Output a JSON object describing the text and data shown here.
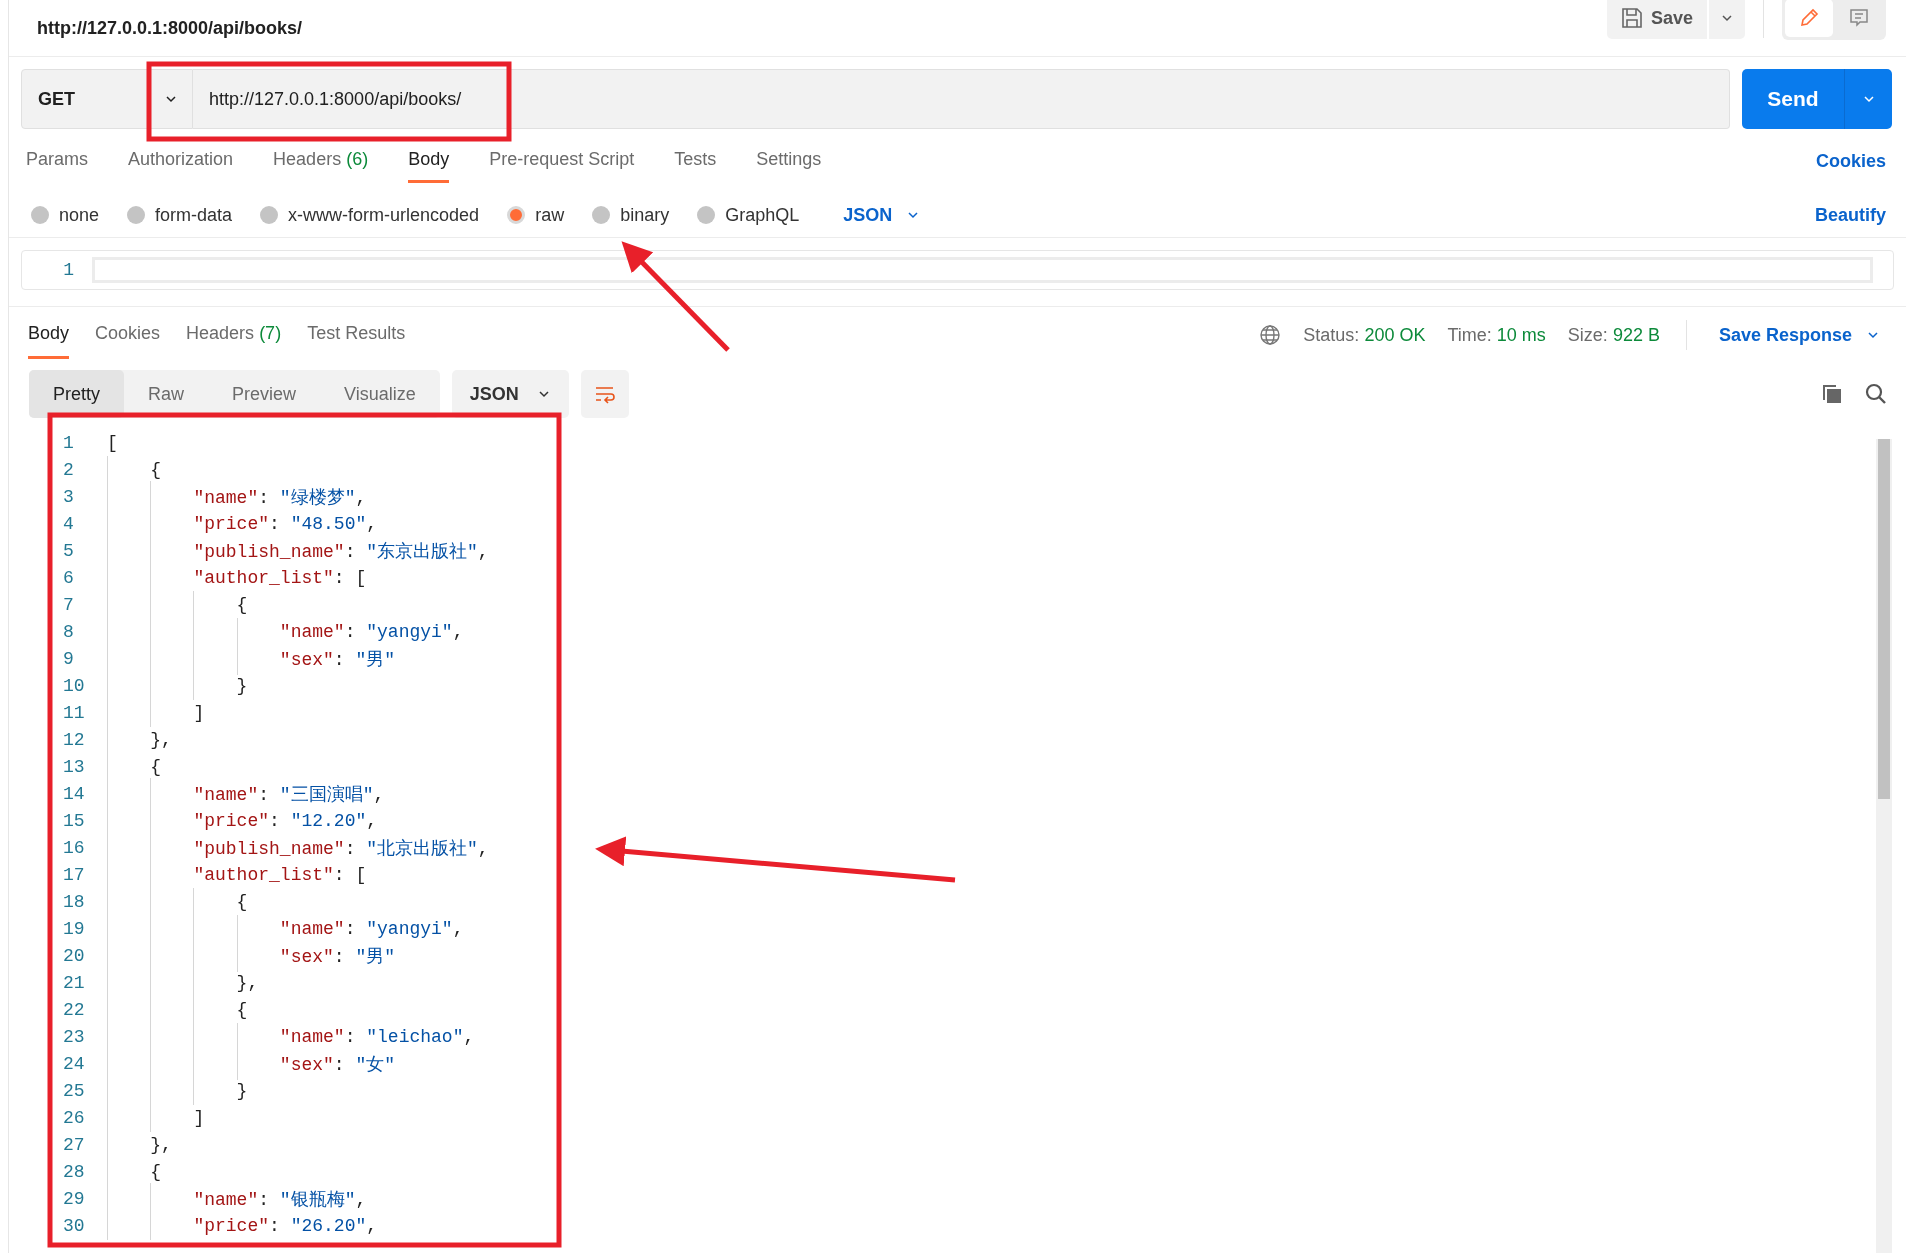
{
  "address_bar": {
    "title": "http://127.0.0.1:8000/api/books/",
    "save": "Save",
    "modes": [
      {
        "kind": "edit",
        "selected": true
      },
      {
        "kind": "comments",
        "selected": false
      }
    ]
  },
  "request": {
    "method": "GET",
    "url": "http://127.0.0.1:8000/api/books/",
    "send": "Send"
  },
  "request_tabs": [
    {
      "label": "Params",
      "selected": false
    },
    {
      "label": "Authorization",
      "selected": false
    },
    {
      "label": "Headers",
      "count": "(6)",
      "selected": false
    },
    {
      "label": "Body",
      "selected": true
    },
    {
      "label": "Pre-request Script",
      "selected": false
    },
    {
      "label": "Tests",
      "selected": false
    },
    {
      "label": "Settings",
      "selected": false
    }
  ],
  "cookies_link": "Cookies",
  "body_types": [
    {
      "label": "none",
      "selected": false
    },
    {
      "label": "form-data",
      "selected": false
    },
    {
      "label": "x-www-form-urlencoded",
      "selected": false
    },
    {
      "label": "raw",
      "selected": true
    },
    {
      "label": "binary",
      "selected": false
    },
    {
      "label": "GraphQL",
      "selected": false
    }
  ],
  "body_format": "JSON",
  "beautify": "Beautify",
  "request_editor": {
    "line_numbers": [
      "1"
    ]
  },
  "response_tabs": [
    {
      "label": "Body",
      "selected": true
    },
    {
      "label": "Cookies",
      "selected": false
    },
    {
      "label": "Headers",
      "count": "(7)",
      "selected": false
    },
    {
      "label": "Test Results",
      "selected": false
    }
  ],
  "response_meta": [
    {
      "label": "Status:",
      "value": "200 OK"
    },
    {
      "label": "Time:",
      "value": "10 ms"
    },
    {
      "label": "Size:",
      "value": "922 B"
    }
  ],
  "save_response": "Save Response",
  "view_modes": [
    {
      "label": "Pretty",
      "selected": true
    },
    {
      "label": "Raw",
      "selected": false
    },
    {
      "label": "Preview",
      "selected": false
    },
    {
      "label": "Visualize",
      "selected": false
    }
  ],
  "response_format": "JSON",
  "response_lines": [
    {
      "number": "1",
      "tokens": [
        {
          "kind": "punct",
          "text": "["
        }
      ]
    },
    {
      "number": "2",
      "tokens": [
        {
          "kind": "punct",
          "text": "    {"
        }
      ]
    },
    {
      "number": "3",
      "tokens": [
        {
          "kind": "key",
          "text": "        \"name\""
        },
        {
          "kind": "punct",
          "text": ": "
        },
        {
          "kind": "string",
          "text": "\"绿楼梦\""
        },
        {
          "kind": "punct",
          "text": ","
        }
      ]
    },
    {
      "number": "4",
      "tokens": [
        {
          "kind": "key",
          "text": "        \"price\""
        },
        {
          "kind": "punct",
          "text": ": "
        },
        {
          "kind": "string",
          "text": "\"48.50\""
        },
        {
          "kind": "punct",
          "text": ","
        }
      ]
    },
    {
      "number": "5",
      "tokens": [
        {
          "kind": "key",
          "text": "        \"publish_name\""
        },
        {
          "kind": "punct",
          "text": ": "
        },
        {
          "kind": "string",
          "text": "\"东京出版社\""
        },
        {
          "kind": "punct",
          "text": ","
        }
      ]
    },
    {
      "number": "6",
      "tokens": [
        {
          "kind": "key",
          "text": "        \"author_list\""
        },
        {
          "kind": "punct",
          "text": ": ["
        }
      ]
    },
    {
      "number": "7",
      "tokens": [
        {
          "kind": "punct",
          "text": "            {"
        }
      ]
    },
    {
      "number": "8",
      "tokens": [
        {
          "kind": "key",
          "text": "                \"name\""
        },
        {
          "kind": "punct",
          "text": ": "
        },
        {
          "kind": "string",
          "text": "\"yangyi\""
        },
        {
          "kind": "punct",
          "text": ","
        }
      ]
    },
    {
      "number": "9",
      "tokens": [
        {
          "kind": "key",
          "text": "                \"sex\""
        },
        {
          "kind": "punct",
          "text": ": "
        },
        {
          "kind": "string",
          "text": "\"男\""
        }
      ]
    },
    {
      "number": "10",
      "tokens": [
        {
          "kind": "punct",
          "text": "            }"
        }
      ]
    },
    {
      "number": "11",
      "tokens": [
        {
          "kind": "punct",
          "text": "        ]"
        }
      ]
    },
    {
      "number": "12",
      "tokens": [
        {
          "kind": "punct",
          "text": "    },"
        }
      ]
    },
    {
      "number": "13",
      "tokens": [
        {
          "kind": "punct",
          "text": "    {"
        }
      ]
    },
    {
      "number": "14",
      "tokens": [
        {
          "kind": "key",
          "text": "        \"name\""
        },
        {
          "kind": "punct",
          "text": ": "
        },
        {
          "kind": "string",
          "text": "\"三国演唱\""
        },
        {
          "kind": "punct",
          "text": ","
        }
      ]
    },
    {
      "number": "15",
      "tokens": [
        {
          "kind": "key",
          "text": "        \"price\""
        },
        {
          "kind": "punct",
          "text": ": "
        },
        {
          "kind": "string",
          "text": "\"12.20\""
        },
        {
          "kind": "punct",
          "text": ","
        }
      ]
    },
    {
      "number": "16",
      "tokens": [
        {
          "kind": "key",
          "text": "        \"publish_name\""
        },
        {
          "kind": "punct",
          "text": ": "
        },
        {
          "kind": "string",
          "text": "\"北京出版社\""
        },
        {
          "kind": "punct",
          "text": ","
        }
      ]
    },
    {
      "number": "17",
      "tokens": [
        {
          "kind": "key",
          "text": "        \"author_list\""
        },
        {
          "kind": "punct",
          "text": ": ["
        }
      ]
    },
    {
      "number": "18",
      "tokens": [
        {
          "kind": "punct",
          "text": "            {"
        }
      ]
    },
    {
      "number": "19",
      "tokens": [
        {
          "kind": "key",
          "text": "                \"name\""
        },
        {
          "kind": "punct",
          "text": ": "
        },
        {
          "kind": "string",
          "text": "\"yangyi\""
        },
        {
          "kind": "punct",
          "text": ","
        }
      ]
    },
    {
      "number": "20",
      "tokens": [
        {
          "kind": "key",
          "text": "                \"sex\""
        },
        {
          "kind": "punct",
          "text": ": "
        },
        {
          "kind": "string",
          "text": "\"男\""
        }
      ]
    },
    {
      "number": "21",
      "tokens": [
        {
          "kind": "punct",
          "text": "            },"
        }
      ]
    },
    {
      "number": "22",
      "tokens": [
        {
          "kind": "punct",
          "text": "            {"
        }
      ]
    },
    {
      "number": "23",
      "tokens": [
        {
          "kind": "key",
          "text": "                \"name\""
        },
        {
          "kind": "punct",
          "text": ": "
        },
        {
          "kind": "string",
          "text": "\"leichao\""
        },
        {
          "kind": "punct",
          "text": ","
        }
      ]
    },
    {
      "number": "24",
      "tokens": [
        {
          "kind": "key",
          "text": "                \"sex\""
        },
        {
          "kind": "punct",
          "text": ": "
        },
        {
          "kind": "string",
          "text": "\"女\""
        }
      ]
    },
    {
      "number": "25",
      "tokens": [
        {
          "kind": "punct",
          "text": "            }"
        }
      ]
    },
    {
      "number": "26",
      "tokens": [
        {
          "kind": "punct",
          "text": "        ]"
        }
      ]
    },
    {
      "number": "27",
      "tokens": [
        {
          "kind": "punct",
          "text": "    },"
        }
      ]
    },
    {
      "number": "28",
      "tokens": [
        {
          "kind": "punct",
          "text": "    {"
        }
      ]
    },
    {
      "number": "29",
      "tokens": [
        {
          "kind": "key",
          "text": "        \"name\""
        },
        {
          "kind": "punct",
          "text": ": "
        },
        {
          "kind": "string",
          "text": "\"银瓶梅\""
        },
        {
          "kind": "punct",
          "text": ","
        }
      ]
    },
    {
      "number": "30",
      "tokens": [
        {
          "kind": "key",
          "text": "        \"price\""
        },
        {
          "kind": "punct",
          "text": ": "
        },
        {
          "kind": "string",
          "text": "\"26.20\""
        },
        {
          "kind": "punct",
          "text": ","
        }
      ]
    }
  ]
}
